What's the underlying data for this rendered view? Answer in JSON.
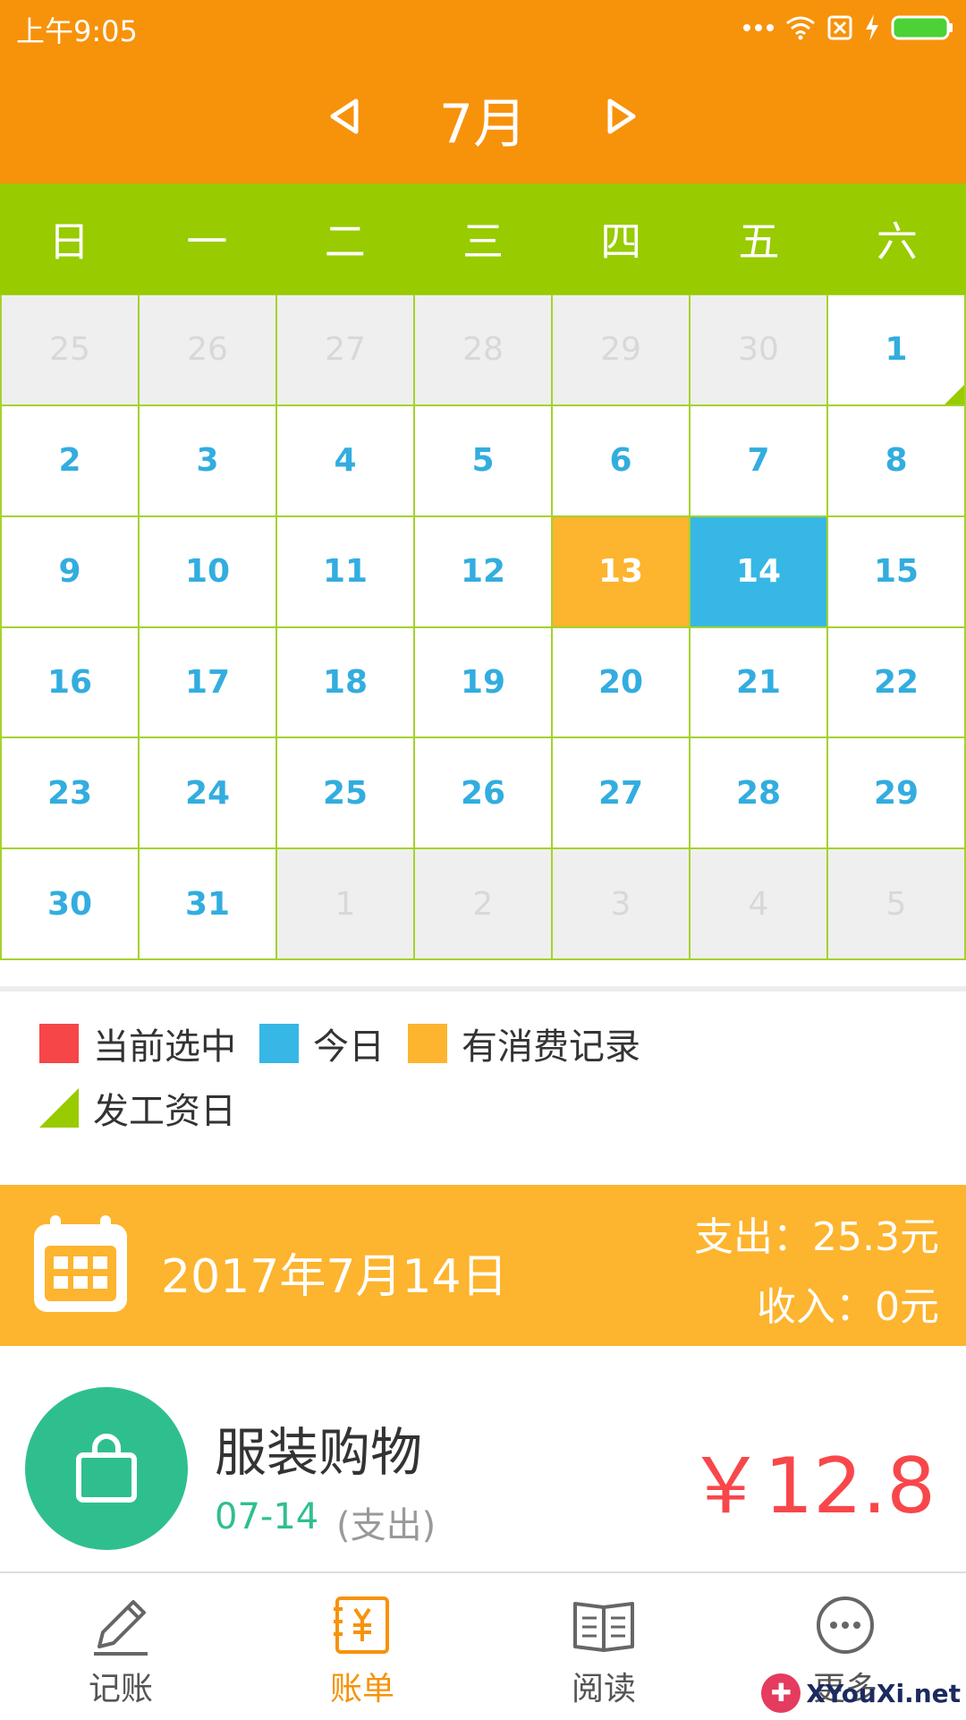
{
  "status": {
    "time": "上午9:05"
  },
  "header": {
    "month": "7月"
  },
  "weekdays": [
    "日",
    "一",
    "二",
    "三",
    "四",
    "五",
    "六"
  ],
  "calendar": {
    "cells": [
      {
        "day": "25",
        "state": "other"
      },
      {
        "day": "26",
        "state": "other"
      },
      {
        "day": "27",
        "state": "other"
      },
      {
        "day": "28",
        "state": "other"
      },
      {
        "day": "29",
        "state": "other"
      },
      {
        "day": "30",
        "state": "other"
      },
      {
        "day": "1",
        "state": "normal",
        "payday": true
      },
      {
        "day": "2",
        "state": "normal"
      },
      {
        "day": "3",
        "state": "normal"
      },
      {
        "day": "4",
        "state": "normal"
      },
      {
        "day": "5",
        "state": "normal"
      },
      {
        "day": "6",
        "state": "normal"
      },
      {
        "day": "7",
        "state": "normal"
      },
      {
        "day": "8",
        "state": "normal"
      },
      {
        "day": "9",
        "state": "normal"
      },
      {
        "day": "10",
        "state": "normal"
      },
      {
        "day": "11",
        "state": "normal"
      },
      {
        "day": "12",
        "state": "normal"
      },
      {
        "day": "13",
        "state": "has-record"
      },
      {
        "day": "14",
        "state": "today"
      },
      {
        "day": "15",
        "state": "normal"
      },
      {
        "day": "16",
        "state": "normal"
      },
      {
        "day": "17",
        "state": "normal"
      },
      {
        "day": "18",
        "state": "normal"
      },
      {
        "day": "19",
        "state": "normal"
      },
      {
        "day": "20",
        "state": "normal"
      },
      {
        "day": "21",
        "state": "normal"
      },
      {
        "day": "22",
        "state": "normal"
      },
      {
        "day": "23",
        "state": "normal"
      },
      {
        "day": "24",
        "state": "normal"
      },
      {
        "day": "25",
        "state": "normal"
      },
      {
        "day": "26",
        "state": "normal"
      },
      {
        "day": "27",
        "state": "normal"
      },
      {
        "day": "28",
        "state": "normal"
      },
      {
        "day": "29",
        "state": "normal"
      },
      {
        "day": "30",
        "state": "normal"
      },
      {
        "day": "31",
        "state": "normal"
      },
      {
        "day": "1",
        "state": "other"
      },
      {
        "day": "2",
        "state": "other"
      },
      {
        "day": "3",
        "state": "other"
      },
      {
        "day": "4",
        "state": "other"
      },
      {
        "day": "5",
        "state": "other"
      }
    ]
  },
  "legend": {
    "selected": {
      "label": "当前选中",
      "color": "#F64647"
    },
    "today": {
      "label": "今日",
      "color": "#36B7E6"
    },
    "record": {
      "label": "有消费记录",
      "color": "#FDB42E"
    },
    "payday": {
      "label": "发工资日",
      "color": "#98CB00"
    }
  },
  "day_summary": {
    "date": "2017年7月14日",
    "expense": "支出：25.3元",
    "income": "收入：0元"
  },
  "records": [
    {
      "icon": "shopping-bag-icon",
      "category": "服装购物",
      "date": "07-14",
      "type": "(支出)",
      "amount": "￥12.8"
    }
  ],
  "tabs": [
    {
      "label": "记账",
      "icon": "pencil-icon"
    },
    {
      "label": "账单",
      "icon": "bill-icon",
      "active": true
    },
    {
      "label": "阅读",
      "icon": "book-icon"
    },
    {
      "label": "更多",
      "icon": "more-icon"
    }
  ],
  "watermark": {
    "text": "XYouXi.net"
  },
  "colors": {
    "header": "#F7920B",
    "weekday_bar": "#98CB00",
    "number": "#33ADDF",
    "amount": "#F8474B"
  }
}
